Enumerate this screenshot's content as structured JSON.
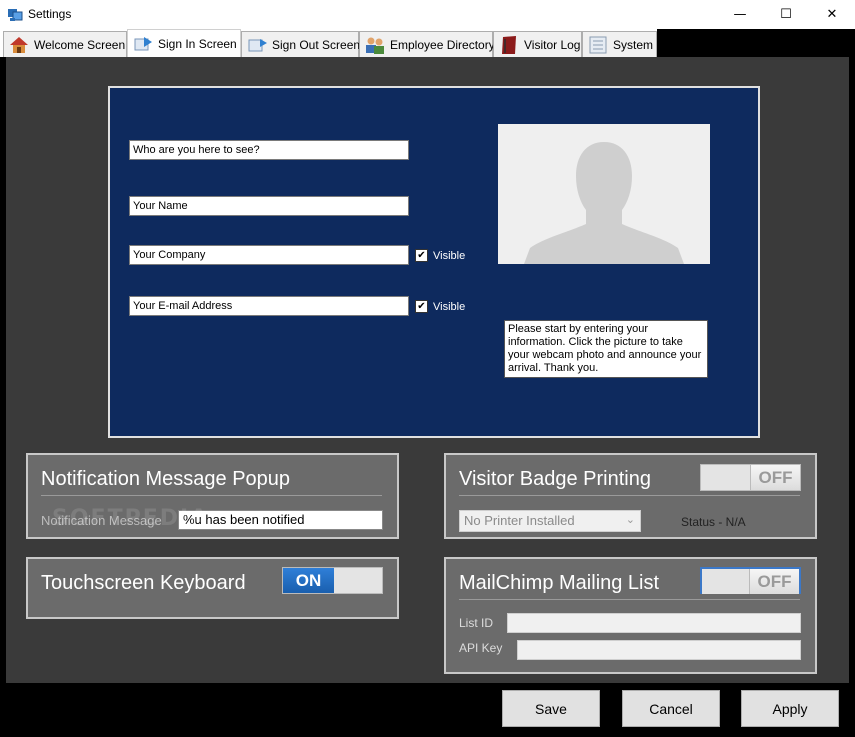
{
  "window": {
    "title": "Settings",
    "controls": {
      "minimize": "—",
      "maximize": "☐",
      "close": "✕"
    }
  },
  "tabs": [
    {
      "label": "Welcome Screen",
      "icon": "house-icon",
      "active": false
    },
    {
      "label": "Sign In Screen",
      "icon": "sign-in-icon",
      "active": true
    },
    {
      "label": "Sign Out Screen",
      "icon": "sign-out-icon",
      "active": false
    },
    {
      "label": "Employee Directory",
      "icon": "people-icon",
      "active": false
    },
    {
      "label": "Visitor Log",
      "icon": "book-icon",
      "active": false
    },
    {
      "label": "System",
      "icon": "server-icon",
      "active": false
    }
  ],
  "preview": {
    "fields": {
      "who": "Who are you here to see?",
      "name": "Your Name",
      "company": "Your Company",
      "email": "Your E-mail Address"
    },
    "company_visible_label": "Visible",
    "email_visible_label": "Visible",
    "company_visible": true,
    "email_visible": true,
    "info_text": "Please start by entering your information. Click the picture to take your webcam photo and announce your arrival. Thank you.",
    "photo_icon": "person-silhouette-icon"
  },
  "notification": {
    "title": "Notification Message Popup",
    "label": "Notification Message",
    "value": "%u has been notified"
  },
  "badge": {
    "title": "Visitor Badge Printing",
    "toggle_label": "OFF",
    "enabled": false,
    "printer": "No Printer Installed",
    "status": "Status - N/A"
  },
  "keyboard": {
    "title": "Touchscreen Keyboard",
    "toggle_label": "ON",
    "enabled": true
  },
  "mailchimp": {
    "title": "MailChimp Mailing List",
    "toggle_label": "OFF",
    "enabled": false,
    "list_id_label": "List ID",
    "list_id_value": "",
    "api_key_label": "API Key",
    "api_key_value": ""
  },
  "watermark": "SOFTPEDIA",
  "buttons": {
    "save": "Save",
    "cancel": "Cancel",
    "apply": "Apply"
  },
  "colors": {
    "preview_background": "#0e2a5e",
    "panel_background": "#6b6b6b",
    "toggle_on": "#1a5fae"
  }
}
